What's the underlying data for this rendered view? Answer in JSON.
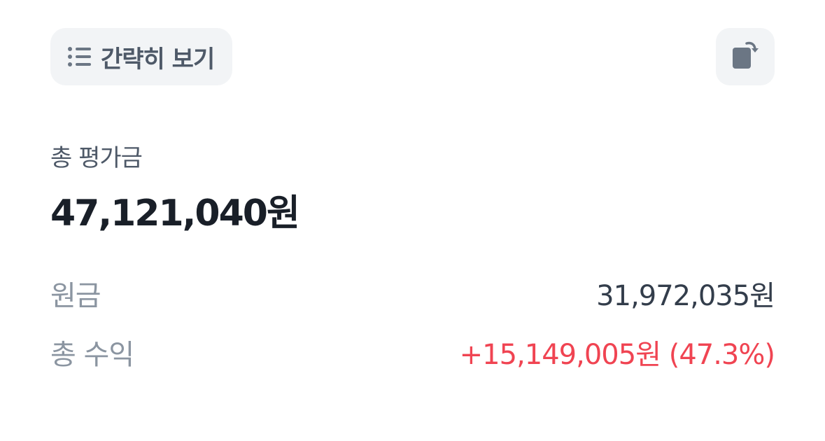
{
  "header": {
    "simple_view_label": "간략히 보기",
    "simple_view_icon": "list-icon",
    "rotate_icon": "rotate-screen-icon"
  },
  "summary": {
    "total_label": "총 평가금",
    "total_value": "47,121,040원"
  },
  "details": {
    "principal_label": "원금",
    "principal_value": "31,972,035원",
    "profit_label": "총 수익",
    "profit_value": "+15,149,005원 (47.3%)"
  },
  "colors": {
    "button_bg": "#f2f4f6",
    "icon": "#6b7684",
    "profit_positive": "#f04452",
    "primary_text": "#191f28",
    "secondary_text": "#8b95a1"
  }
}
